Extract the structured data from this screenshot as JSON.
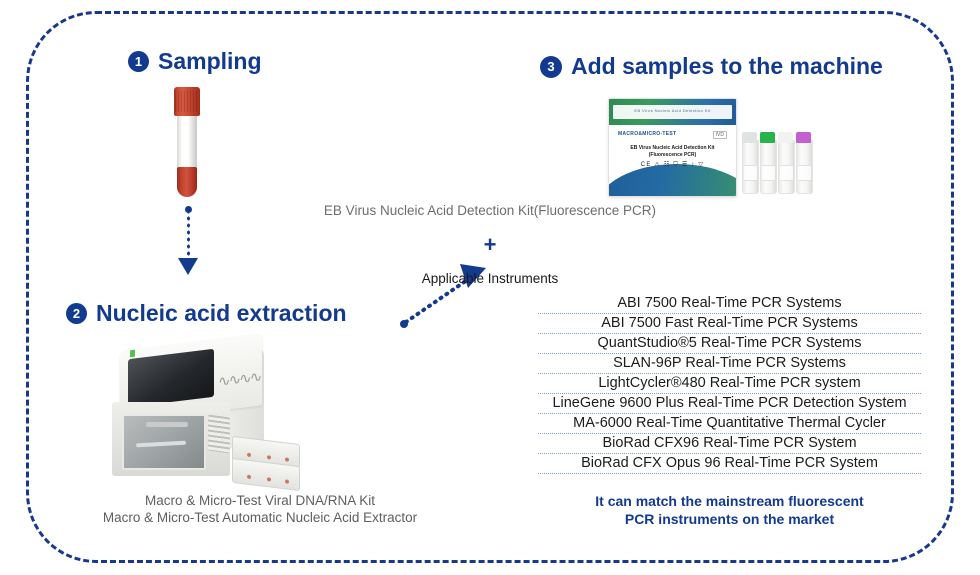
{
  "colors": {
    "brand_blue": "#123a8f",
    "frame_dash": "#17388c",
    "caption_gray": "#6d6d6d",
    "separator_dotted": "#7f9fd0",
    "tube_red": "#c1432e",
    "kit_green": "#3a9a5e",
    "kit_blue": "#1f5b96"
  },
  "steps": {
    "step1": {
      "number": "1",
      "title": "Sampling"
    },
    "step2": {
      "number": "2",
      "title": "Nucleic acid extraction"
    },
    "step3": {
      "number": "3",
      "title": "Add samples to the machine"
    }
  },
  "step1_graphic": {
    "item": "blood-collection-tube"
  },
  "step2_graphic": {
    "item": "automatic-nucleic-acid-extractor",
    "caption_line1": "Macro & Micro-Test Viral DNA/RNA Kit",
    "caption_line2": "Macro & Micro-Test Automatic Nucleic Acid Extractor"
  },
  "step3_graphic": {
    "kit_caption": "EB Virus Nucleic Acid Detection Kit(Fluorescence PCR)",
    "kit_box": {
      "top_strip_text": "EB Virus Nucleic Acid Detection Kit",
      "logo": "MACRO&MICRO-TEST",
      "ivd_mark": "IVD",
      "name_line1": "EB Virus Nucleic Acid Detection Kit",
      "name_line2": "(Fluorescence PCR)",
      "symbols": "CE  ⚠  ☷  ⛉  ☰  ↑  ▽"
    },
    "vials": [
      {
        "name": "vial-clear",
        "cap_color": "#dfe3e1"
      },
      {
        "name": "vial-green",
        "cap_color": "#27b34a"
      },
      {
        "name": "vial-white",
        "cap_color": "#f2f2f0"
      },
      {
        "name": "vial-purple",
        "cap_color": "#c35fd0"
      }
    ],
    "plus": "+",
    "applicable_label": "Applicable Instruments",
    "instruments": [
      "ABI 7500 Real-Time PCR Systems",
      "ABI 7500 Fast Real-Time PCR Systems",
      "QuantStudio®5 Real-Time PCR Systems",
      "SLAN-96P Real-Time PCR Systems",
      "LightCycler®480 Real-Time PCR system",
      "LineGene 9600 Plus Real-Time PCR Detection System",
      "MA-6000 Real-Time Quantitative Thermal Cycler",
      "BioRad CFX96 Real-Time PCR System",
      "BioRad CFX Opus 96 Real-Time PCR System"
    ],
    "match_note_line1": "It can match the mainstream fluorescent",
    "match_note_line2": "PCR instruments on the market"
  }
}
